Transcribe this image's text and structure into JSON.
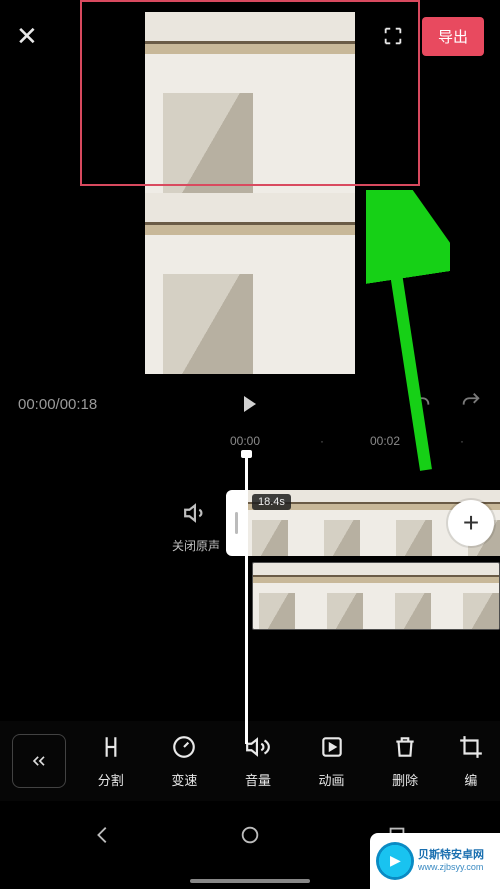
{
  "header": {
    "export_label": "导出"
  },
  "playbar": {
    "time": "00:00/00:18"
  },
  "ruler": {
    "t0": "00:00",
    "t1": "00:02"
  },
  "timeline": {
    "mute_label": "关闭原声",
    "clip_duration": "18.4s"
  },
  "tools": {
    "split": "分割",
    "speed": "变速",
    "volume": "音量",
    "animation": "动画",
    "delete": "删除",
    "edit": "编"
  },
  "watermark": {
    "title": "贝斯特安卓网",
    "url": "www.zjbsyy.com"
  },
  "colors": {
    "accent": "#e84a5f",
    "arrow": "#16d016"
  }
}
